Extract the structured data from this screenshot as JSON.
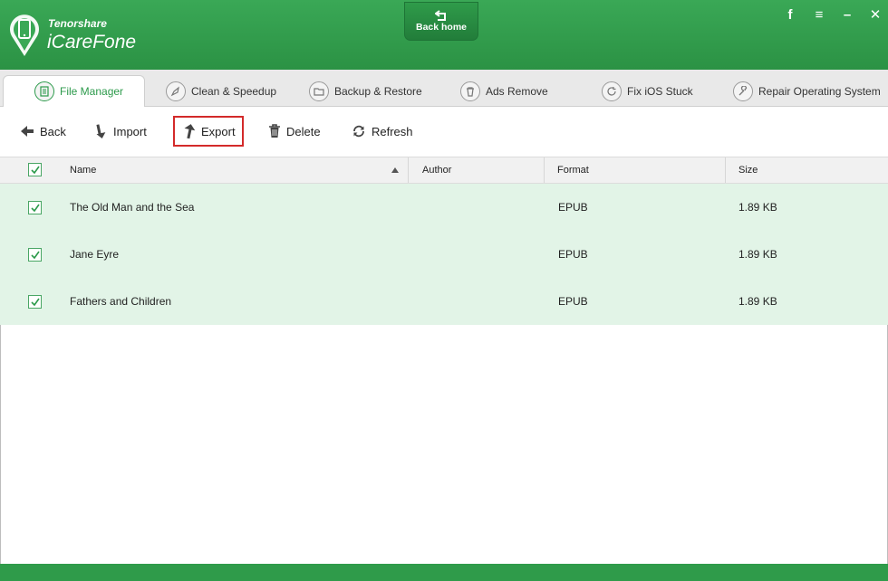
{
  "app": {
    "brand_small": "Tenorshare",
    "brand_name": "iCareFone",
    "back_home_label": "Back home"
  },
  "window_controls": [
    "f",
    "≡",
    "–",
    "✕"
  ],
  "tabs": [
    {
      "label": "File Manager",
      "icon": "file-manager-icon",
      "active": true
    },
    {
      "label": "Clean & Speedup",
      "icon": "rocket-icon"
    },
    {
      "label": "Backup & Restore",
      "icon": "folder-icon"
    },
    {
      "label": "Ads Remove",
      "icon": "trash-icon"
    },
    {
      "label": "Fix iOS Stuck",
      "icon": "refresh-icon"
    },
    {
      "label": "Repair Operating System",
      "icon": "wrench-icon"
    }
  ],
  "toolbar": {
    "back": "Back",
    "import": "Import",
    "export": "Export",
    "delete": "Delete",
    "refresh": "Refresh"
  },
  "table": {
    "columns": [
      "Name",
      "Author",
      "Format",
      "Size"
    ],
    "rows": [
      {
        "name": "The Old Man and the Sea",
        "author": "",
        "format": "EPUB",
        "size": "1.89 KB",
        "checked": true
      },
      {
        "name": "Jane Eyre",
        "author": "",
        "format": "EPUB",
        "size": "1.89 KB",
        "checked": true
      },
      {
        "name": "Fathers and Children",
        "author": "",
        "format": "EPUB",
        "size": "1.89 KB",
        "checked": true
      }
    ]
  },
  "colors": {
    "brand_green": "#2f9b4a",
    "row_selected": "#e2f4e7",
    "highlight_border": "#d32a2a"
  }
}
